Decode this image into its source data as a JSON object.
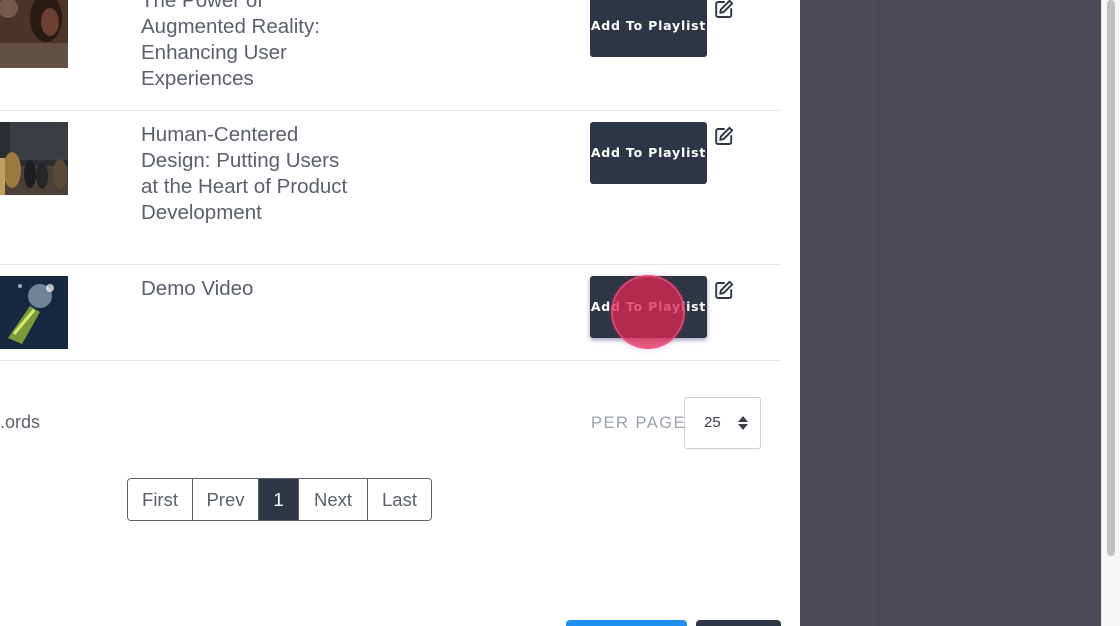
{
  "videos": [
    {
      "title": "The Power of Augmented Reality: Enhancing User Experiences",
      "add_label": "Add To Playlist"
    },
    {
      "title": "Human-Centered Design: Putting Users at the Heart of Product Development",
      "add_label": "Add To Playlist"
    },
    {
      "title": "Demo Video",
      "add_label": "Add To Playlist"
    }
  ],
  "footer": {
    "records_text": "ords.",
    "per_page_label": "PER PAGE",
    "per_page_value": "25"
  },
  "pagination": {
    "first": "First",
    "prev": "Prev",
    "current": "1",
    "next": "Next",
    "last": "Last"
  },
  "colors": {
    "button_dark": "#2e3646",
    "sidebar": "#4a4b57",
    "click_indicator": "#da2856",
    "primary_blue": "#1f8ff0"
  },
  "icons": {
    "edit": "edit-pencil-square-icon",
    "sort": "sort-arrows-icon"
  }
}
